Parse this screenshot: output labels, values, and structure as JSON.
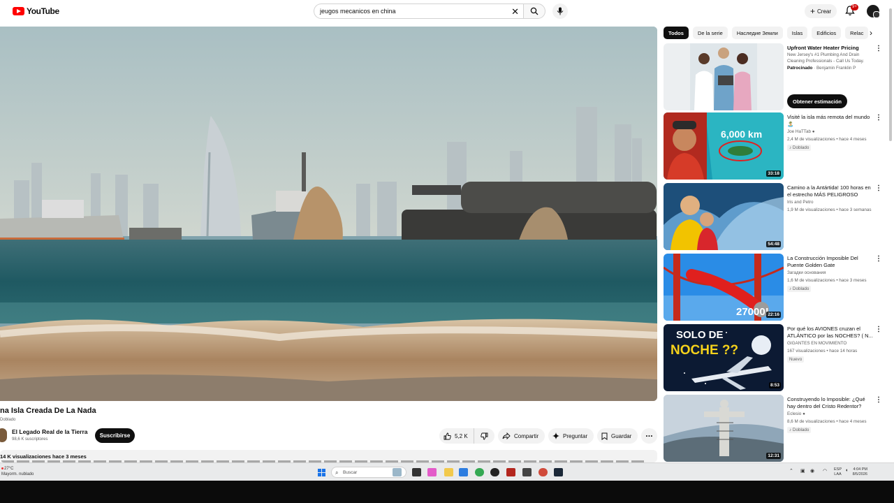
{
  "app": {
    "logo_text": "YouTube"
  },
  "search": {
    "query": "jeugos mecanicos en china"
  },
  "header": {
    "create_label": "Crear",
    "notif_count": "9+"
  },
  "video": {
    "title": "na Isla Creada De La Nada",
    "dubbed": "Doblado",
    "channel": "El Legado Real de la Tierra",
    "subs": "98,6 K suscriptores",
    "subscribe": "Suscribirse",
    "likes": "5,2 K",
    "share": "Compartir",
    "ask": "Preguntar",
    "save": "Guardar",
    "views_date": "14 K visualizaciones  hace 3 meses"
  },
  "chips": [
    "Todos",
    "De la serie",
    "Наследие Земли",
    "Islas",
    "Edificios",
    "Relac"
  ],
  "ad": {
    "title": "Upfront Water Heater Pricing",
    "desc": "New Jersey's #1 Plumbing And Drain Cleaning Professionals - Call Us Today.",
    "sponsored": "Patrocinado",
    "advertiser": "· Benjamin Franklin P",
    "cta": "Obtener estimación"
  },
  "recs": [
    {
      "title": "Visité la isla más remota del mundo 🏝️",
      "channel": "Joe HaTTab",
      "meta": "2,4 M de visualizaciones • hace 4 meses",
      "badge": "Doblado",
      "duration": "33:18",
      "overlay": "6,000 km"
    },
    {
      "title": "Camino a la Antártida! 100 horas en el estrecho MÁS PELIGROSO",
      "channel": "Iris and Petro",
      "meta": "1,9 M de visualizaciones • hace 3 semanas",
      "badge": "",
      "duration": "54:48",
      "overlay": ""
    },
    {
      "title": "La Construcción Imposible Del Puente Golden Gate",
      "channel": "Загадки основания",
      "meta": "1,6 M de visualizaciones • hace 3 meses",
      "badge": "Doblado",
      "duration": "22:16",
      "overlay": "27000!"
    },
    {
      "title": "Por qué los AVIONES cruzan el ATLÁNTICO por las NOCHES? ( N...",
      "channel": "GIGANTES EN MOVIMIENTO",
      "meta": "167 visualizaciones • hace 14 horas",
      "badge": "Nuevo",
      "duration": "8:53",
      "overlay": "SOLO DE NOCHE ??"
    },
    {
      "title": "Construyendo lo Imposible: ¿Qué hay dentro del Cristo Redentor?",
      "channel": "Eclesio",
      "meta": "8,6 M de visualizaciones • hace 4 meses",
      "badge": "Doblado",
      "duration": "12:31",
      "overlay": ""
    }
  ],
  "taskbar": {
    "weather_temp": "27°C",
    "weather_desc": "Mayorm. nublado",
    "search_placeholder": "Buscar",
    "lang_1": "ESP",
    "lang_2": "LAA",
    "time": "4:04 PM",
    "date": "8/5/2026"
  }
}
